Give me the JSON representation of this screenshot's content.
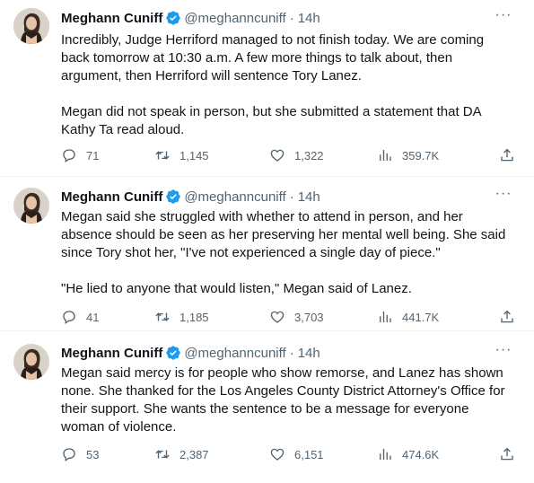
{
  "tweets": [
    {
      "author": "Meghann Cuniff",
      "handle": "@meghanncuniff",
      "time": "14h",
      "text": "Incredibly, Judge Herriford managed to not finish today. We are coming back tomorrow at 10:30 a.m. A few more things to talk about, then argument, then Herriford will sentence Tory Lanez.\n\nMegan did not speak in person, but she submitted a statement that DA Kathy Ta read aloud.",
      "replies": "71",
      "retweets": "1,145",
      "likes": "1,322",
      "views": "359.7K"
    },
    {
      "author": "Meghann Cuniff",
      "handle": "@meghanncuniff",
      "time": "14h",
      "text": "Megan said she struggled with whether to attend in person, and her absence should be seen as her preserving her mental well being. She said since Tory shot her, \"I've not experienced a single day of piece.\"\n\n\"He lied to anyone that would listen,\" Megan said of Lanez.",
      "replies": "41",
      "retweets": "1,185",
      "likes": "3,703",
      "views": "441.7K"
    },
    {
      "author": "Meghann Cuniff",
      "handle": "@meghanncuniff",
      "time": "14h",
      "text": "Megan said mercy is for people who show remorse, and Lanez has shown none. She thanked for the Los Angeles County District Attorney's Office for their support. She wants the sentence to be a message for everyone woman of violence.",
      "replies": "53",
      "retweets": "2,387",
      "likes": "6,151",
      "views": "474.6K"
    }
  ],
  "dot": "·",
  "more_glyph": "···",
  "icons": {
    "reply": "reply-icon",
    "retweet": "retweet-icon",
    "like": "heart-icon",
    "views": "views-icon",
    "share": "share-icon",
    "verified": "verified-badge-icon"
  },
  "colors": {
    "text": "#0f1419",
    "secondary": "#536471",
    "verified": "#1d9bf0",
    "divider": "#eff3f4"
  }
}
